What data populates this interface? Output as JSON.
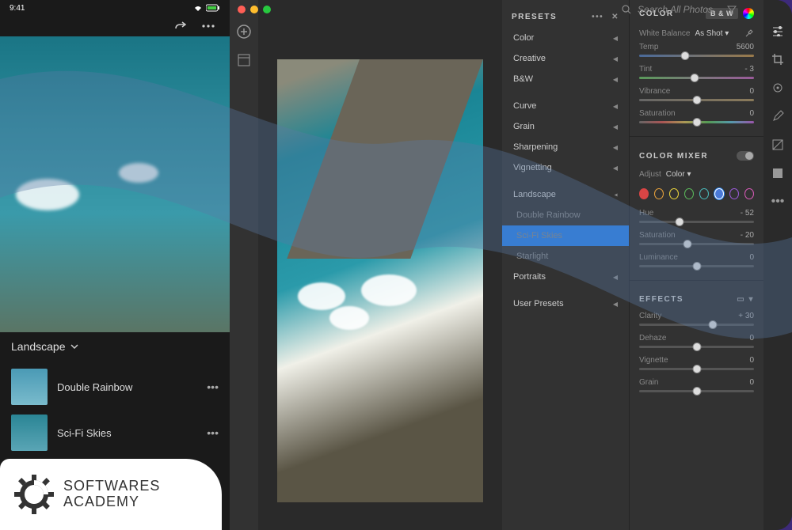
{
  "mobile": {
    "status_time": "9:41",
    "redo_label": "Redo",
    "more_label": "More",
    "category": "Landscape",
    "presets": [
      {
        "label": "Double Rainbow"
      },
      {
        "label": "Sci-Fi Skies"
      }
    ]
  },
  "desktop": {
    "search_placeholder": "Search All Photos",
    "presets_panel": {
      "title": "PRESETS",
      "groups": [
        {
          "label": "Color",
          "expanded": false
        },
        {
          "label": "Creative",
          "expanded": false
        },
        {
          "label": "B&W",
          "expanded": false
        }
      ],
      "groups2": [
        {
          "label": "Curve",
          "expanded": false
        },
        {
          "label": "Grain",
          "expanded": false
        },
        {
          "label": "Sharpening",
          "expanded": false
        },
        {
          "label": "Vignetting",
          "expanded": false
        }
      ],
      "landscape": {
        "label": "Landscape",
        "items": [
          {
            "label": "Double Rainbow",
            "selected": false
          },
          {
            "label": "Sci-Fi Skies",
            "selected": true
          },
          {
            "label": "Starlight",
            "selected": false
          }
        ]
      },
      "portraits_label": "Portraits",
      "user_presets_label": "User Presets"
    },
    "color_panel": {
      "title": "COLOR",
      "bw_chip": "B & W",
      "white_balance_label": "White Balance",
      "white_balance_value": "As Shot",
      "sliders": {
        "temp": {
          "label": "Temp",
          "value": "5600",
          "pos": 40
        },
        "tint": {
          "label": "Tint",
          "value": "- 3",
          "pos": 48
        },
        "vibrance": {
          "label": "Vibrance",
          "value": "0",
          "pos": 50
        },
        "saturation": {
          "label": "Saturation",
          "value": "0",
          "pos": 50
        }
      }
    },
    "color_mixer": {
      "title": "COLOR MIXER",
      "adjust_label": "Adjust",
      "adjust_value": "Color",
      "colors": [
        "red",
        "orange",
        "yellow",
        "green",
        "aqua",
        "blue",
        "purple",
        "magenta"
      ],
      "active_color": "blue",
      "sliders": {
        "hue": {
          "label": "Hue",
          "value": "- 52",
          "pos": 35
        },
        "saturation": {
          "label": "Saturation",
          "value": "- 20",
          "pos": 42
        },
        "luminance": {
          "label": "Luminance",
          "value": "0",
          "pos": 50
        }
      }
    },
    "effects": {
      "title": "EFFECTS",
      "sliders": {
        "clarity": {
          "label": "Clarity",
          "value": "+ 30",
          "pos": 64
        },
        "dehaze": {
          "label": "Dehaze",
          "value": "0",
          "pos": 50
        },
        "vignette": {
          "label": "Vignette",
          "value": "0",
          "pos": 50
        },
        "grain": {
          "label": "Grain",
          "value": "0",
          "pos": 50
        }
      }
    }
  },
  "watermark": {
    "line1": "SOFTWARES",
    "line2": "ACADEMY"
  }
}
